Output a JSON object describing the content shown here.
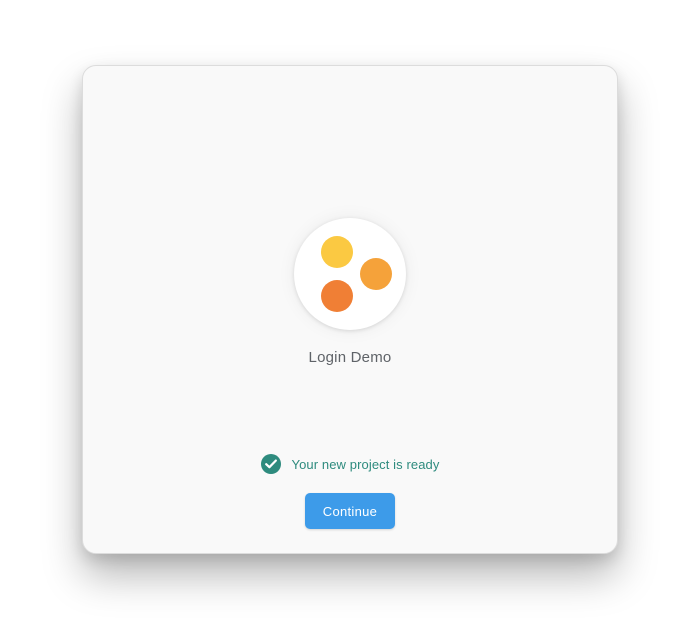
{
  "app": {
    "name": "Login Demo",
    "logo_icon": "three-dots-logo-icon",
    "logo_colors": [
      "#fbc942",
      "#f5a23a",
      "#f07f35"
    ]
  },
  "status": {
    "icon": "check-circle-icon",
    "message": "Your new project is ready",
    "color": "#2e8b7e"
  },
  "actions": {
    "continue_label": "Continue",
    "continue_color": "#3d9be9"
  }
}
